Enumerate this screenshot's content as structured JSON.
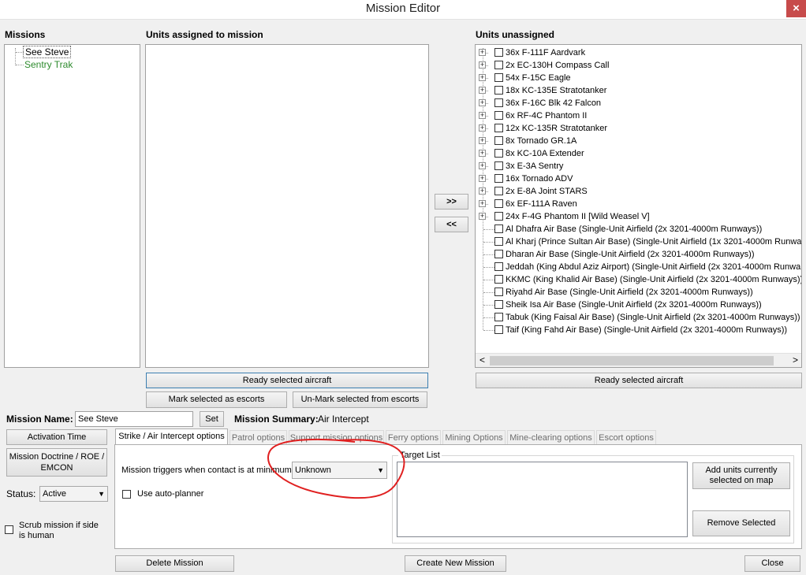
{
  "window": {
    "title": "Mission Editor",
    "close_glyph": "×"
  },
  "missions": {
    "header": "Missions",
    "items": [
      {
        "label": "See Steve",
        "color": "#000000"
      },
      {
        "label": "Sentry Trak",
        "color": "#2e8b2e"
      }
    ]
  },
  "assigned": {
    "header": "Units assigned to mission"
  },
  "transfer": {
    "add": ">>",
    "remove": "<<"
  },
  "unassigned": {
    "header": "Units unassigned",
    "units": [
      {
        "label": "36x F-111F Aardvark",
        "expandable": true
      },
      {
        "label": "2x EC-130H Compass Call",
        "expandable": true
      },
      {
        "label": "54x F-15C Eagle",
        "expandable": true
      },
      {
        "label": "18x KC-135E Stratotanker",
        "expandable": true
      },
      {
        "label": "36x F-16C Blk 42 Falcon",
        "expandable": true
      },
      {
        "label": "6x RF-4C Phantom II",
        "expandable": true
      },
      {
        "label": "12x KC-135R Stratotanker",
        "expandable": true
      },
      {
        "label": "8x Tornado GR.1A",
        "expandable": true
      },
      {
        "label": "8x KC-10A Extender",
        "expandable": true
      },
      {
        "label": "3x E-3A Sentry",
        "expandable": true
      },
      {
        "label": "16x Tornado ADV",
        "expandable": true
      },
      {
        "label": "2x E-8A Joint STARS",
        "expandable": true
      },
      {
        "label": "6x EF-111A Raven",
        "expandable": true
      },
      {
        "label": "24x F-4G Phantom II [Wild Weasel V]",
        "expandable": true
      },
      {
        "label": "Al Dhafra Air Base (Single-Unit Airfield (2x 3201-4000m Runways))",
        "expandable": false
      },
      {
        "label": "Al Kharj (Prince Sultan Air Base) (Single-Unit Airfield (1x 3201-4000m Runwa",
        "expandable": false
      },
      {
        "label": "Dharan Air Base (Single-Unit Airfield (2x 3201-4000m Runways))",
        "expandable": false
      },
      {
        "label": "Jeddah (King Abdul Aziz Airport) (Single-Unit Airfield (2x 3201-4000m Runwa",
        "expandable": false
      },
      {
        "label": "KKMC (King Khalid Air Base) (Single-Unit Airfield (2x 3201-4000m Runways))",
        "expandable": false
      },
      {
        "label": "Riyahd Air Base (Single-Unit Airfield (2x 3201-4000m Runways))",
        "expandable": false
      },
      {
        "label": "Sheik Isa Air Base (Single-Unit Airfield (2x 3201-4000m Runways))",
        "expandable": false
      },
      {
        "label": "Tabuk (King Faisal Air Base) (Single-Unit Airfield (2x 3201-4000m Runways))",
        "expandable": false
      },
      {
        "label": "Taif (King Fahd Air Base) (Single-Unit Airfield (2x 3201-4000m Runways))",
        "expandable": false
      }
    ],
    "scroll_left": "<",
    "scroll_right": ">"
  },
  "buttons": {
    "ready_left": "Ready selected aircraft",
    "ready_right": "Ready selected aircraft",
    "mark_escorts": "Mark selected as escorts",
    "unmark_escorts": "Un-Mark selected from escorts",
    "set": "Set",
    "activation_time": "Activation Time",
    "doctrine": "Mission Doctrine / ROE / EMCON",
    "add_units": "Add units currently selected on map",
    "remove_selected": "Remove Selected",
    "delete_mission": "Delete Mission",
    "create_mission": "Create New Mission",
    "close": "Close"
  },
  "mission": {
    "name_label": "Mission Name:",
    "name_value": "See Steve",
    "summary_label": "Mission Summary:",
    "summary_value": "Air Intercept",
    "status_label": "Status:",
    "status_value": "Active",
    "scrub_label": "Scrub mission if side is human"
  },
  "tabs": [
    "Strike / Air Intercept options",
    "Patrol options",
    "Support mission options",
    "Ferry options",
    "Mining Options",
    "Mine-clearing options",
    "Escort options"
  ],
  "strike": {
    "trigger_label": "Mission triggers when contact is at minimum:",
    "trigger_value": "Unknown",
    "autoplanner_label": "Use auto-planner",
    "target_list_label": "Target List"
  },
  "annotation_color": "#e02020"
}
